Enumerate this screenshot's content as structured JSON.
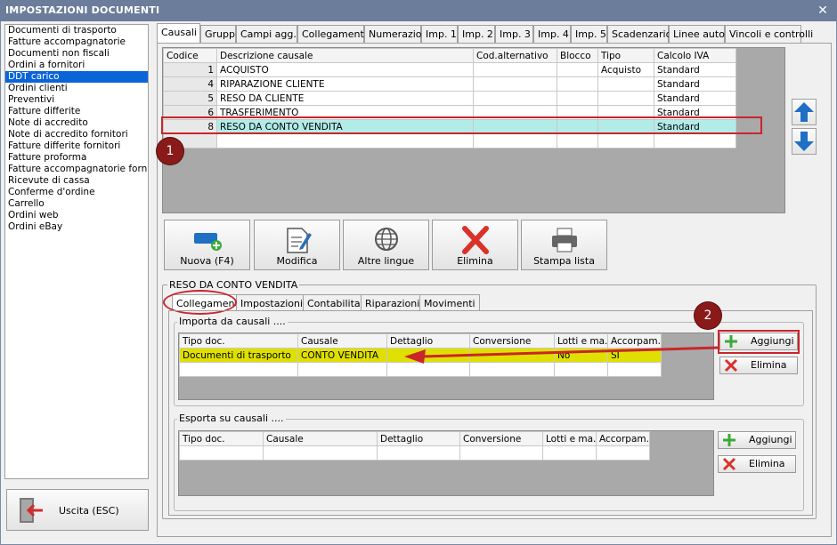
{
  "window": {
    "title": "IMPOSTAZIONI DOCUMENTI",
    "close_glyph": "✕"
  },
  "left_list": {
    "items": [
      "Documenti di trasporto",
      "Fatture accompagnatorie",
      "Documenti non fiscali",
      "Ordini a fornitori",
      "DDT carico",
      "Ordini clienti",
      "Preventivi",
      "Fatture differite",
      "Note di accredito",
      "Note di accredito fornitori",
      "Fatture differite fornitori",
      "Fatture proforma",
      "Fatture accompagnatorie fornito",
      "Ricevute di cassa",
      "Conferme d'ordine",
      "Carrello",
      "Ordini web",
      "Ordini eBay"
    ],
    "selected_index": 4
  },
  "exit_button": {
    "label": "Uscita (ESC)",
    "icon": "exit-door-icon"
  },
  "tabs": [
    "Causali",
    "Gruppi",
    "Campi agg.",
    "Collegamenti",
    "Numerazioni",
    "Imp. 1",
    "Imp. 2",
    "Imp. 3",
    "Imp. 4",
    "Imp. 5",
    "Scadenzario",
    "Linee auto",
    "Vincoli e controlli"
  ],
  "active_tab": "Causali",
  "causali_table": {
    "headers": [
      "Codice",
      "Descrizione causale",
      "Cod.alternativo",
      "Blocco",
      "Tipo",
      "Calcolo IVA"
    ],
    "rows": [
      [
        "1",
        "ACQUISTO",
        "",
        "",
        "Acquisto",
        "Standard"
      ],
      [
        "4",
        "RIPARAZIONE CLIENTE",
        "",
        "",
        "",
        "Standard"
      ],
      [
        "5",
        "RESO DA CLIENTE",
        "",
        "",
        "",
        "Standard"
      ],
      [
        "6",
        "TRASFERIMENTO",
        "",
        "",
        "",
        "Standard"
      ],
      [
        "8",
        "RESO DA CONTO VENDITA",
        "",
        "",
        "",
        "Standard"
      ]
    ],
    "highlight_row": 4
  },
  "annotations": {
    "marker1": "1",
    "marker2": "2"
  },
  "toolbar": [
    {
      "label": "Nuova (F4)",
      "icon": "new-document-icon"
    },
    {
      "label": "Modifica",
      "icon": "edit-pencil-icon"
    },
    {
      "label": "Altre lingue",
      "icon": "globe-icon"
    },
    {
      "label": "Elimina",
      "icon": "red-x-icon"
    },
    {
      "label": "Stampa lista",
      "icon": "printer-icon"
    }
  ],
  "detail": {
    "group_title": "RESO DA CONTO VENDITA",
    "subtabs": [
      "Collegamenti",
      "Impostazioni",
      "Contabilita'",
      "Riparazioni",
      "Movimenti"
    ],
    "active_subtab": "Collegamenti",
    "import": {
      "title": "Importa da causali ....",
      "headers": [
        "Tipo doc.",
        "Causale",
        "Dettaglio",
        "Conversione",
        "Lotti e ma...",
        "Accorpam..."
      ],
      "rows": [
        [
          "Documenti di trasporto",
          "CONTO VENDITA",
          "",
          "",
          "No",
          "SI"
        ]
      ],
      "add_label": "Aggiungi",
      "delete_label": "Elimina"
    },
    "export": {
      "title": "Esporta su causali ....",
      "headers": [
        "Tipo doc.",
        "Causale",
        "Dettaglio",
        "Conversione",
        "Lotti e ma...",
        "Accorpam..."
      ],
      "rows": [],
      "add_label": "Aggiungi",
      "delete_label": "Elimina"
    }
  },
  "colors": {
    "title_bar": "#6b7d9a",
    "selection": "#0a64d8",
    "highlight_row": "#b2ece8",
    "annotation_red": "#c8262b",
    "yellow_row": "#e0e000"
  }
}
